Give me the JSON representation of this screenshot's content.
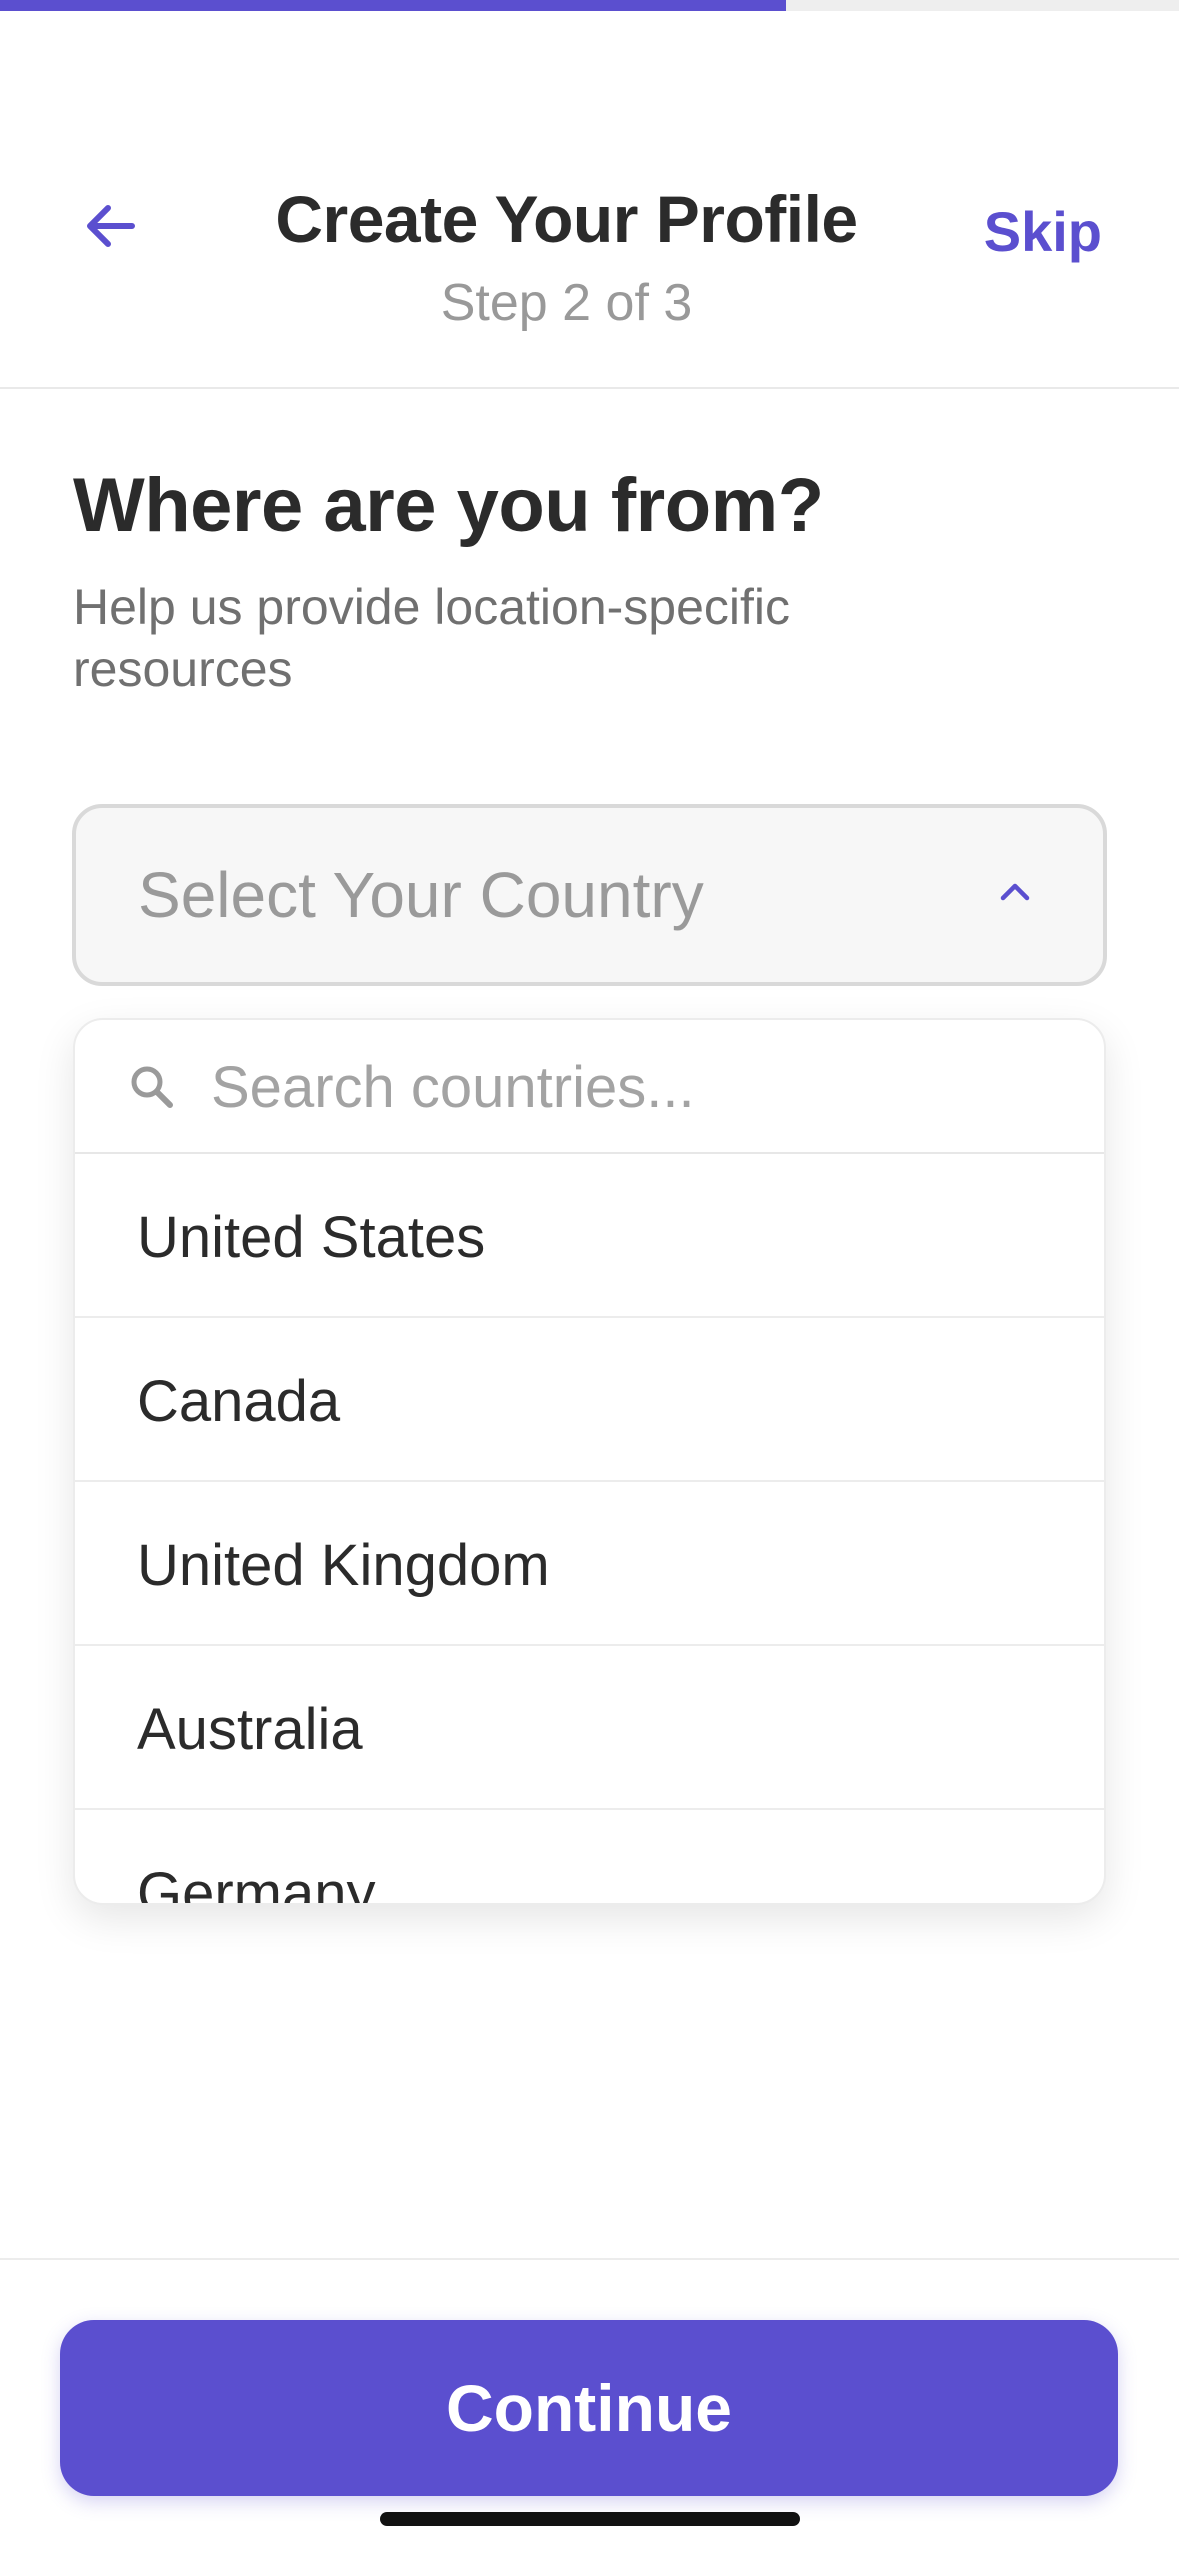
{
  "progress": {
    "fraction": 0.667,
    "fill_color": "#5b4fcf",
    "track_color": "#eeeeee"
  },
  "header": {
    "back_icon": "arrow-left-icon",
    "title": "Create Your Profile",
    "step": "Step 2 of 3",
    "skip_label": "Skip"
  },
  "question": {
    "heading": "Where are you from?",
    "subtext": "Help us provide location-specific resources"
  },
  "country_select": {
    "placeholder": "Select Your Country",
    "chevron_icon": "chevron-up-icon",
    "expanded": true
  },
  "dropdown": {
    "search_icon": "search-icon",
    "search_placeholder": "Search countries...",
    "search_value": "",
    "countries": [
      "United States",
      "Canada",
      "United Kingdom",
      "Australia",
      "Germany"
    ]
  },
  "footer": {
    "continue_label": "Continue"
  },
  "colors": {
    "accent": "#5b4fcf",
    "text_primary": "#2b2b2b",
    "text_secondary": "#707070",
    "placeholder": "#9a9a9a"
  }
}
